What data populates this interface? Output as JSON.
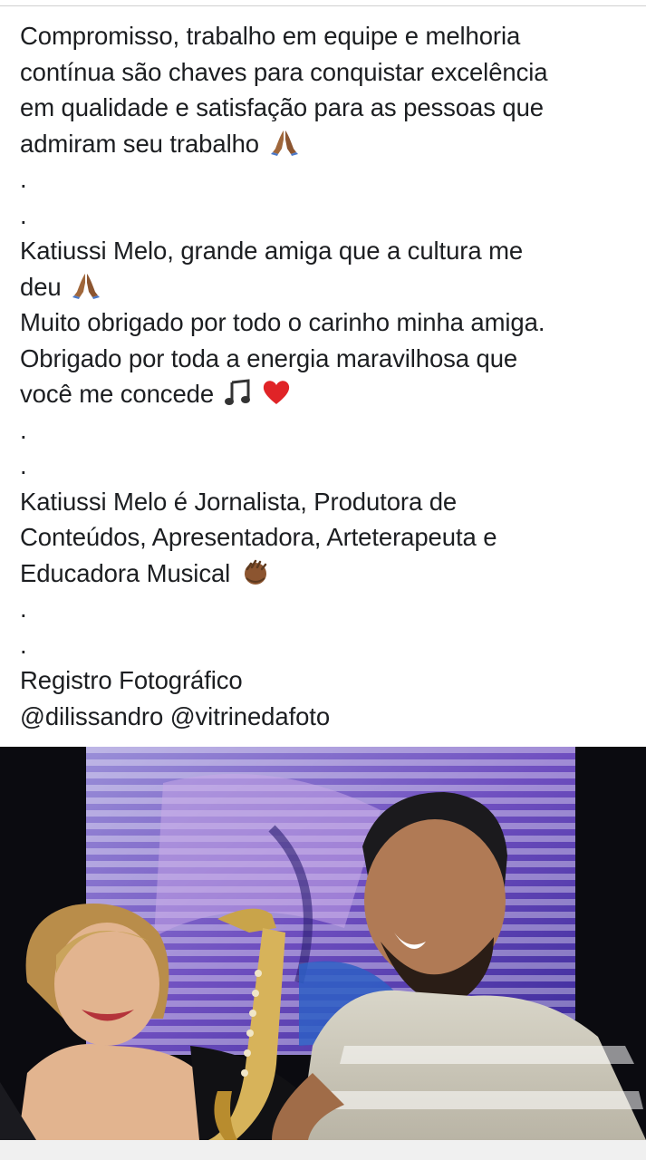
{
  "post": {
    "lines": [
      "Compromisso, trabalho em equipe e melhoria",
      "contínua são chaves para conquistar excelência",
      "em qualidade e satisfação para as pessoas que",
      "admiram seu trabalho",
      ".",
      ".",
      "Katiussi Melo, grande amiga que a cultura me",
      "deu",
      "Muito obrigado por todo o carinho minha amiga.",
      "Obrigado por toda a energia maravilhosa que",
      "você me concede",
      ".",
      ".",
      "Katiussi Melo é Jornalista, Produtora de",
      "Conteúdos, Apresentadora, Arteterapeuta e",
      "Educadora Musical",
      ".",
      ".",
      "Registro Fotográfico",
      "@dilissandro @vitrinedafoto"
    ],
    "emojis": {
      "line4": "praying-hands-icon",
      "line8": "praying-hands-icon",
      "line11": [
        "music-note-icon",
        "red-heart-icon"
      ],
      "line16": "clapping-hands-icon"
    }
  },
  "photo": {
    "subject": "woman-with-saxophone-and-man-laughing"
  },
  "colors": {
    "text": "#1c1e21",
    "background": "#ffffff",
    "photo_bg": "#0b0b10",
    "emoji_skin": "#a0673b"
  }
}
